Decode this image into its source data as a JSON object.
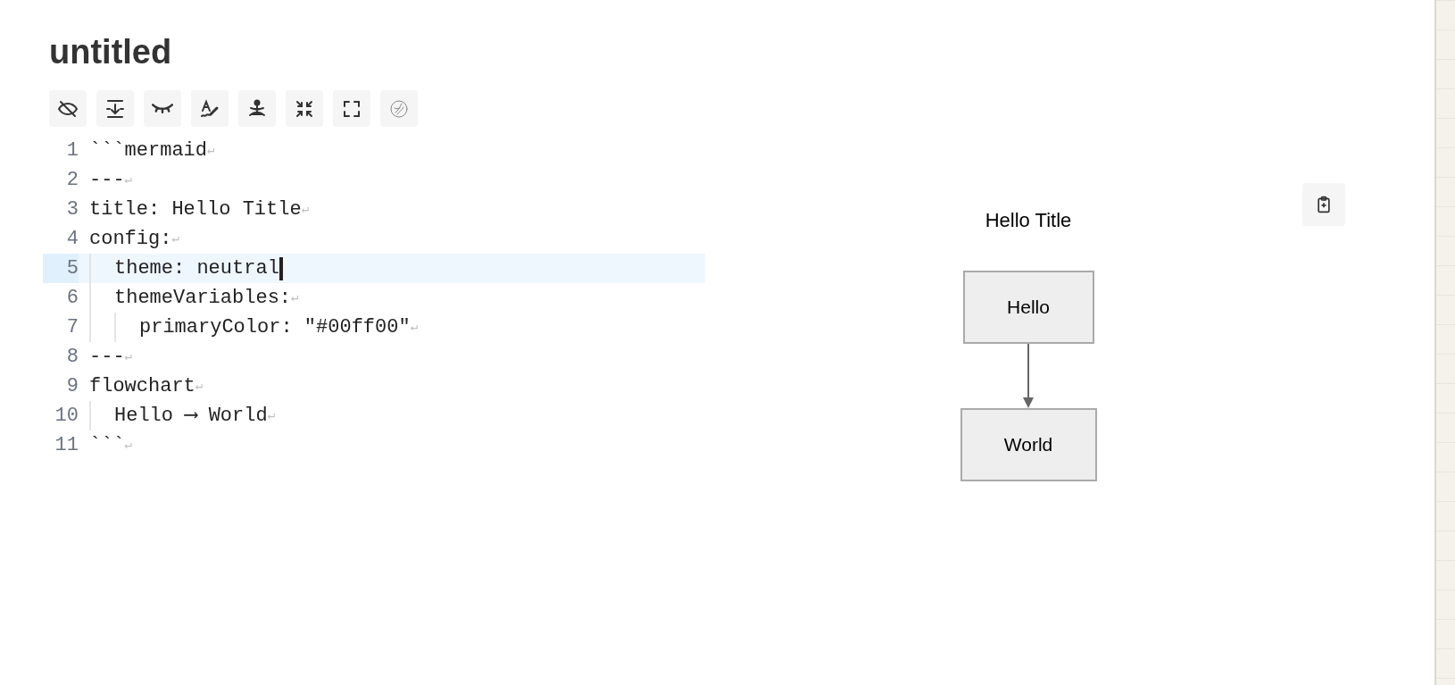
{
  "document": {
    "title": "untitled"
  },
  "editor": {
    "lines": [
      {
        "number": "1",
        "text": "```mermaid",
        "eol": "↵",
        "current": false
      },
      {
        "number": "2",
        "text": "---",
        "eol": "↵",
        "current": false
      },
      {
        "number": "3",
        "text": "title: Hello Title",
        "eol": "↵",
        "current": false
      },
      {
        "number": "4",
        "text": "config:",
        "eol": "↵",
        "current": false,
        "children": [
          {
            "number": "5",
            "text": "theme: neutral",
            "current": true
          },
          {
            "number": "6",
            "text": "themeVariables:",
            "eol": "↵",
            "current": false,
            "children": [
              {
                "number": "7",
                "text": "primaryColor: \"#00ff00\"",
                "eol": "↵",
                "current": false
              }
            ]
          }
        ]
      },
      {
        "number": "8",
        "text": "---",
        "eol": "↵",
        "current": false
      },
      {
        "number": "9",
        "text": "flowchart",
        "eol": "↵",
        "current": false,
        "children": [
          {
            "number": "10",
            "text": "Hello ⟶ World",
            "eol": "↵",
            "current": false
          }
        ]
      },
      {
        "number": "11",
        "text": "```",
        "eol": "↵",
        "current": false
      }
    ]
  },
  "preview": {
    "title": "Hello Title",
    "nodes": [
      {
        "label": "Hello"
      },
      {
        "label": "World"
      }
    ]
  }
}
